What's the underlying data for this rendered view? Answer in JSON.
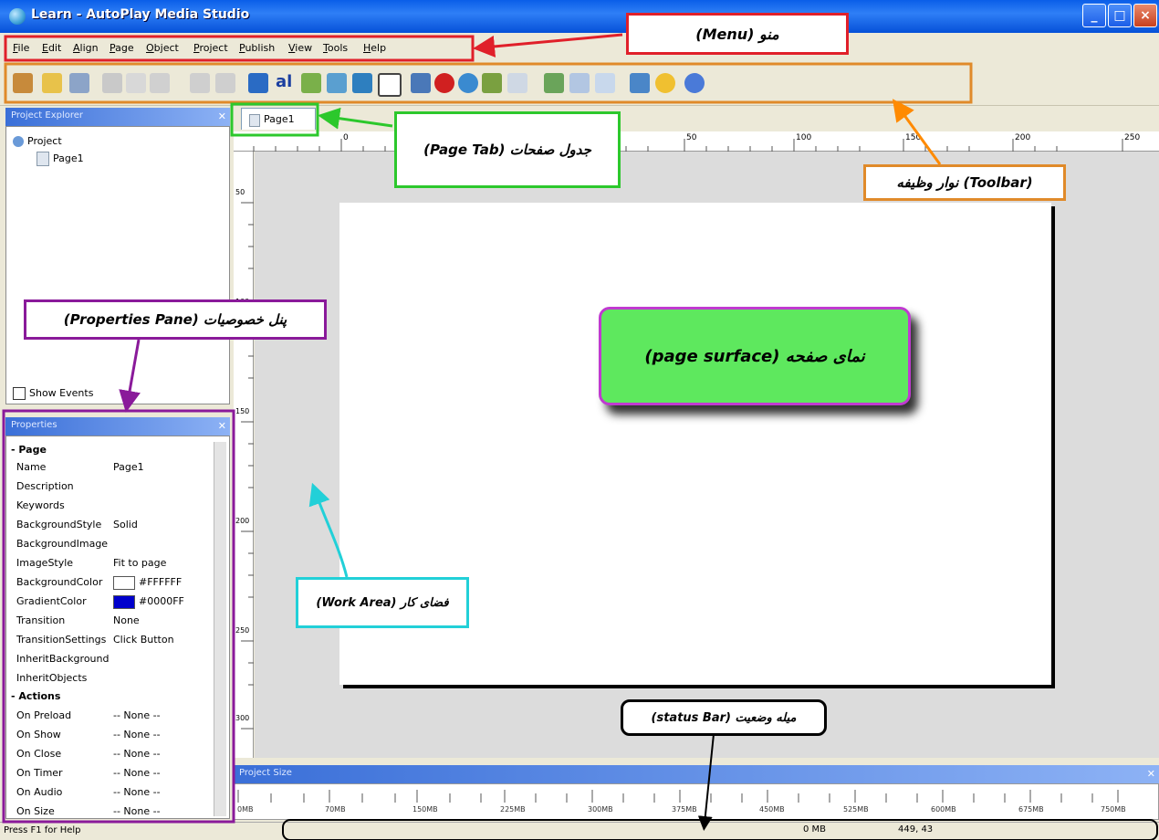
{
  "window": {
    "title": "Learn - AutoPlay Media Studio",
    "min": "_",
    "max": "□",
    "close": "×"
  },
  "menu": [
    "File",
    "Edit",
    "Align",
    "Page",
    "Object",
    "Project",
    "Publish",
    "View",
    "Tools",
    "Help"
  ],
  "toolbar_icons": [
    "wizard",
    "open",
    "save",
    "cut",
    "copy",
    "paste",
    "undo",
    "redo",
    "button",
    "label",
    "paragraph",
    "image",
    "flash",
    "rectangle",
    "video",
    "web",
    "slideshow",
    "tree",
    "zoom",
    "page-new",
    "page-delete",
    "preview",
    "publish",
    "effects",
    "help"
  ],
  "explorer": {
    "title": "Project Explorer",
    "root": "Project",
    "page": "Page1",
    "show_events": "Show Events"
  },
  "properties": {
    "title": "Properties",
    "section_page": "Page",
    "rows": [
      {
        "k": "Name",
        "v": "Page1"
      },
      {
        "k": "Description",
        "v": ""
      },
      {
        "k": "Keywords",
        "v": ""
      },
      {
        "k": "BackgroundStyle",
        "v": "Solid"
      },
      {
        "k": "BackgroundImage",
        "v": ""
      },
      {
        "k": "ImageStyle",
        "v": "Fit to page"
      },
      {
        "k": "BackgroundColor",
        "v": "#FFFFFF"
      },
      {
        "k": "GradientColor",
        "v": "#0000FF"
      },
      {
        "k": "Transition",
        "v": "None"
      },
      {
        "k": "TransitionSettings",
        "v": "Click Button"
      },
      {
        "k": "InheritBackground",
        "v": ""
      },
      {
        "k": "InheritObjects",
        "v": ""
      }
    ],
    "section_actions": "Actions",
    "actions": [
      {
        "k": "On Preload",
        "v": "-- None --"
      },
      {
        "k": "On Show",
        "v": "-- None --"
      },
      {
        "k": "On Close",
        "v": "-- None --"
      },
      {
        "k": "On Timer",
        "v": "-- None --"
      },
      {
        "k": "On Audio",
        "v": "-- None --"
      },
      {
        "k": "On Size",
        "v": "-- None --"
      }
    ]
  },
  "colors": {
    "bg_swatch": "#FFFFFF",
    "gradient_swatch": "#0000CC"
  },
  "page_tab": "Page1",
  "ruler_top": [
    "0",
    "50",
    "100",
    "150",
    "200",
    "250"
  ],
  "ruler_left": [
    "50",
    "100",
    "150",
    "200",
    "250",
    "300"
  ],
  "project_size": {
    "title": "Project Size",
    "labels": [
      "0MB",
      "70MB",
      "150MB",
      "225MB",
      "300MB",
      "375MB",
      "450MB",
      "525MB",
      "600MB",
      "675MB",
      "750MB"
    ]
  },
  "status": {
    "help": "Press F1 for Help",
    "size": "0 MB",
    "coords": "449, 43"
  },
  "callouts": {
    "menu": "(Menu)  منو",
    "toolbar": "نوار وظیفه (Toolbar)",
    "page_tab": "(Page Tab)  جدول صفحات",
    "properties": "(Properties Pane) پنل خصوصیات",
    "page_surface": "(page surface) نمای صفحه",
    "work_area": "(Work Area) فضای کار",
    "status_bar": "(status Bar) میله وضعیت"
  }
}
